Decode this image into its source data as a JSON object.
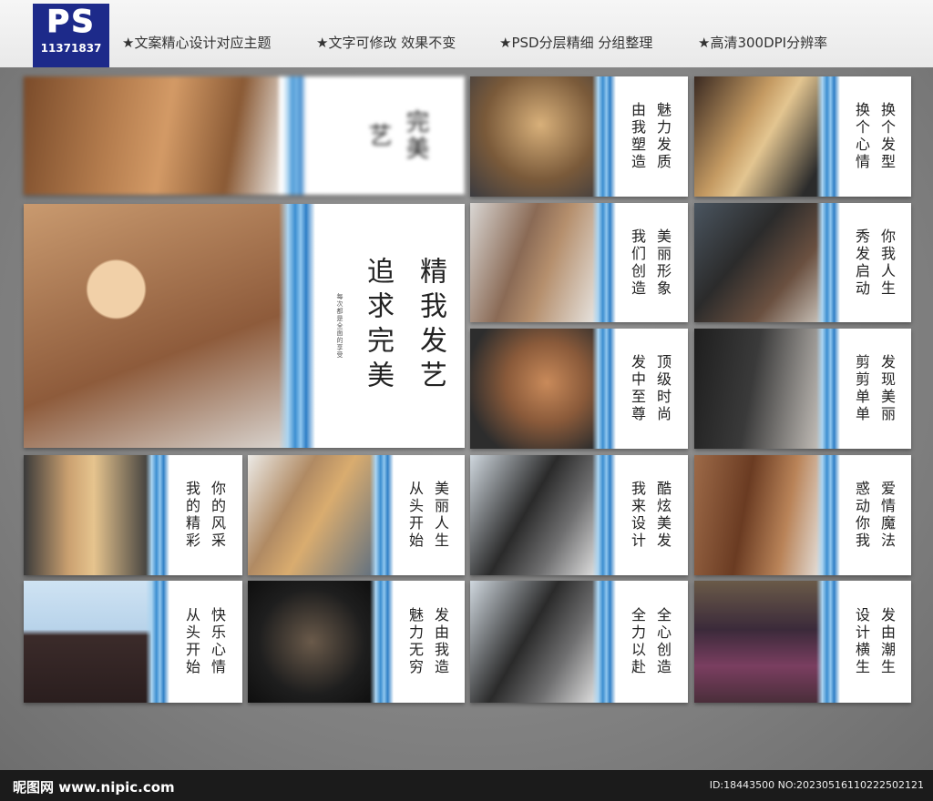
{
  "header": {
    "ps_logo": "PS",
    "ps_id": "11371837",
    "features": [
      "★文案精心设计对应主题",
      "★文字可修改 效果不变",
      "★PSD分层精细 分组整理",
      "★高清300DPI分辨率"
    ]
  },
  "cards": {
    "top_banner": {
      "cols": [
        "完美",
        "艺"
      ]
    },
    "hero": {
      "cols": [
        "精我发艺",
        "追求完美"
      ],
      "note": "每次都是全面的享受"
    },
    "c1": {
      "cols": [
        "魅力发质",
        "由我塑造"
      ]
    },
    "c2": {
      "cols": [
        "换个发型",
        "换个心情"
      ]
    },
    "c3": {
      "cols": [
        "美丽形象",
        "我们创造"
      ]
    },
    "c4": {
      "cols": [
        "你我人生",
        "秀发启动"
      ]
    },
    "c5": {
      "cols": [
        "顶级时尚",
        "发中至尊"
      ]
    },
    "c6": {
      "cols": [
        "发现美丽",
        "剪剪单单"
      ]
    },
    "c7": {
      "cols": [
        "你的风采",
        "我的精彩"
      ]
    },
    "c8": {
      "cols": [
        "美丽人生",
        "从头开始"
      ]
    },
    "c9": {
      "cols": [
        "酷炫美发",
        "我来设计"
      ]
    },
    "c10": {
      "cols": [
        "爱情魔法",
        "惑动你我"
      ]
    },
    "c11": {
      "cols": [
        "快乐心情",
        "从头开始"
      ]
    },
    "c12": {
      "cols": [
        "发由我造",
        "魅力无穷"
      ]
    },
    "c13": {
      "cols": [
        "全心创造",
        "全力以赴"
      ]
    },
    "c14": {
      "cols": [
        "发由潮生",
        "设计横生"
      ]
    }
  },
  "footer": {
    "site": "昵图网 www.nipic.com",
    "id_text": "ID:18443500 NO:20230516110222502121"
  }
}
